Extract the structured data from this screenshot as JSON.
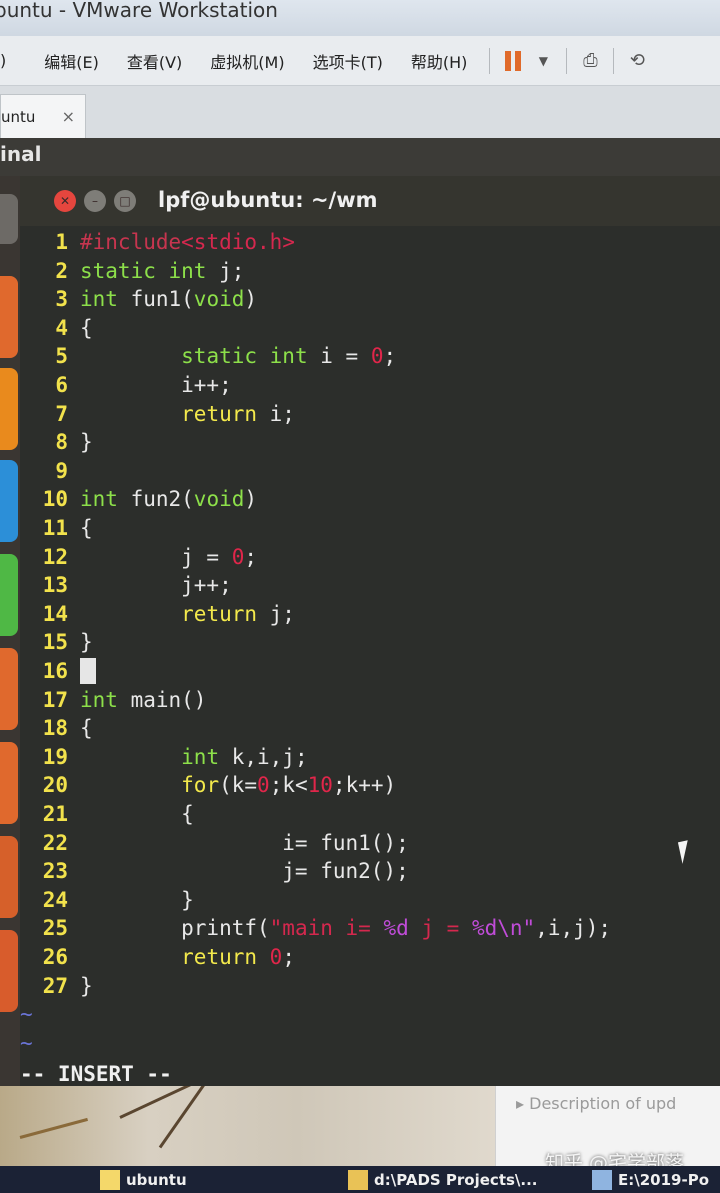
{
  "window": {
    "title": "buntu - VMware Workstation"
  },
  "menu": {
    "items": [
      "编辑(E)",
      "查看(V)",
      "虚拟机(M)",
      "选项卡(T)",
      "帮助(H)"
    ],
    "first_fragment": ")"
  },
  "tabs": {
    "active": "untu",
    "close": "×"
  },
  "vm_header": {
    "label": "inal"
  },
  "terminal": {
    "title": "lpf@ubuntu: ~/wm",
    "mode": "-- INSERT --"
  },
  "code": {
    "lines": [
      {
        "n": "1",
        "segs": [
          {
            "t": "#include",
            "c": "pre"
          },
          {
            "t": "<stdio.h>",
            "c": "str"
          }
        ]
      },
      {
        "n": "2",
        "segs": [
          {
            "t": "static int",
            "c": "kw"
          },
          {
            "t": " j;",
            "c": "txt"
          }
        ]
      },
      {
        "n": "3",
        "segs": [
          {
            "t": "int",
            "c": "ty"
          },
          {
            "t": " fun1(",
            "c": "txt"
          },
          {
            "t": "void",
            "c": "ty"
          },
          {
            "t": ")",
            "c": "txt"
          }
        ]
      },
      {
        "n": "4",
        "segs": [
          {
            "t": "{",
            "c": "txt"
          }
        ]
      },
      {
        "n": "5",
        "segs": [
          {
            "t": "        ",
            "c": "txt"
          },
          {
            "t": "static int",
            "c": "kw"
          },
          {
            "t": " i = ",
            "c": "txt"
          },
          {
            "t": "0",
            "c": "num"
          },
          {
            "t": ";",
            "c": "txt"
          }
        ]
      },
      {
        "n": "6",
        "segs": [
          {
            "t": "        i++;",
            "c": "txt"
          }
        ]
      },
      {
        "n": "7",
        "segs": [
          {
            "t": "        ",
            "c": "txt"
          },
          {
            "t": "return",
            "c": "ctl"
          },
          {
            "t": " i;",
            "c": "txt"
          }
        ]
      },
      {
        "n": "8",
        "segs": [
          {
            "t": "}",
            "c": "txt"
          }
        ]
      },
      {
        "n": "9",
        "segs": []
      },
      {
        "n": "10",
        "segs": [
          {
            "t": "int",
            "c": "ty"
          },
          {
            "t": " fun2(",
            "c": "txt"
          },
          {
            "t": "void",
            "c": "ty"
          },
          {
            "t": ")",
            "c": "txt"
          }
        ]
      },
      {
        "n": "11",
        "segs": [
          {
            "t": "{",
            "c": "txt"
          }
        ]
      },
      {
        "n": "12",
        "segs": [
          {
            "t": "        j = ",
            "c": "txt"
          },
          {
            "t": "0",
            "c": "num"
          },
          {
            "t": ";",
            "c": "txt"
          }
        ]
      },
      {
        "n": "13",
        "segs": [
          {
            "t": "        j++;",
            "c": "txt"
          }
        ]
      },
      {
        "n": "14",
        "segs": [
          {
            "t": "        ",
            "c": "txt"
          },
          {
            "t": "return",
            "c": "ctl"
          },
          {
            "t": " j;",
            "c": "txt"
          }
        ]
      },
      {
        "n": "15",
        "segs": [
          {
            "t": "}",
            "c": "txt"
          }
        ]
      },
      {
        "n": "16",
        "segs": [],
        "cursor": true
      },
      {
        "n": "17",
        "segs": [
          {
            "t": "int",
            "c": "ty"
          },
          {
            "t": " main()",
            "c": "txt"
          }
        ]
      },
      {
        "n": "18",
        "segs": [
          {
            "t": "{",
            "c": "txt"
          }
        ]
      },
      {
        "n": "19",
        "segs": [
          {
            "t": "        ",
            "c": "txt"
          },
          {
            "t": "int",
            "c": "ty"
          },
          {
            "t": " k,i,j;",
            "c": "txt"
          }
        ]
      },
      {
        "n": "20",
        "segs": [
          {
            "t": "        ",
            "c": "txt"
          },
          {
            "t": "for",
            "c": "ctl"
          },
          {
            "t": "(k=",
            "c": "txt"
          },
          {
            "t": "0",
            "c": "num"
          },
          {
            "t": ";k<",
            "c": "txt"
          },
          {
            "t": "10",
            "c": "num"
          },
          {
            "t": ";k++)",
            "c": "txt"
          }
        ]
      },
      {
        "n": "21",
        "segs": [
          {
            "t": "        {",
            "c": "txt"
          }
        ]
      },
      {
        "n": "22",
        "segs": [
          {
            "t": "                i= fun1();",
            "c": "txt"
          }
        ]
      },
      {
        "n": "23",
        "segs": [
          {
            "t": "                j= fun2();",
            "c": "txt"
          }
        ]
      },
      {
        "n": "24",
        "segs": [
          {
            "t": "        }",
            "c": "txt"
          }
        ]
      },
      {
        "n": "25",
        "segs": [
          {
            "t": "        printf(",
            "c": "txt"
          },
          {
            "t": "\"main i= ",
            "c": "str"
          },
          {
            "t": "%d",
            "c": "fmt"
          },
          {
            "t": " j = ",
            "c": "str"
          },
          {
            "t": "%d",
            "c": "fmt"
          },
          {
            "t": "\\n\"",
            "c": "fmt"
          },
          {
            "t": ",i,j);",
            "c": "txt"
          }
        ]
      },
      {
        "n": "26",
        "segs": [
          {
            "t": "        ",
            "c": "txt"
          },
          {
            "t": "return",
            "c": "ctl"
          },
          {
            "t": " ",
            "c": "txt"
          },
          {
            "t": "0",
            "c": "num"
          },
          {
            "t": ";",
            "c": "txt"
          }
        ]
      },
      {
        "n": "27",
        "segs": [
          {
            "t": "}",
            "c": "txt"
          }
        ]
      }
    ],
    "empty_marker": "~"
  },
  "desktop": {
    "description": "▸ Description of upd",
    "watermark": "知乎 @宅学部落"
  },
  "taskbar": {
    "items": [
      "ubuntu",
      "d:\\PADS Projects\\...",
      "E:\\2019-Po"
    ]
  },
  "colors": {
    "terminal_bg": "#2c2e2b",
    "line_number": "#f2e24c",
    "keyword": "#8de04a",
    "control": "#f3e94c",
    "number": "#e0264a",
    "close_button": "#e5463e"
  }
}
